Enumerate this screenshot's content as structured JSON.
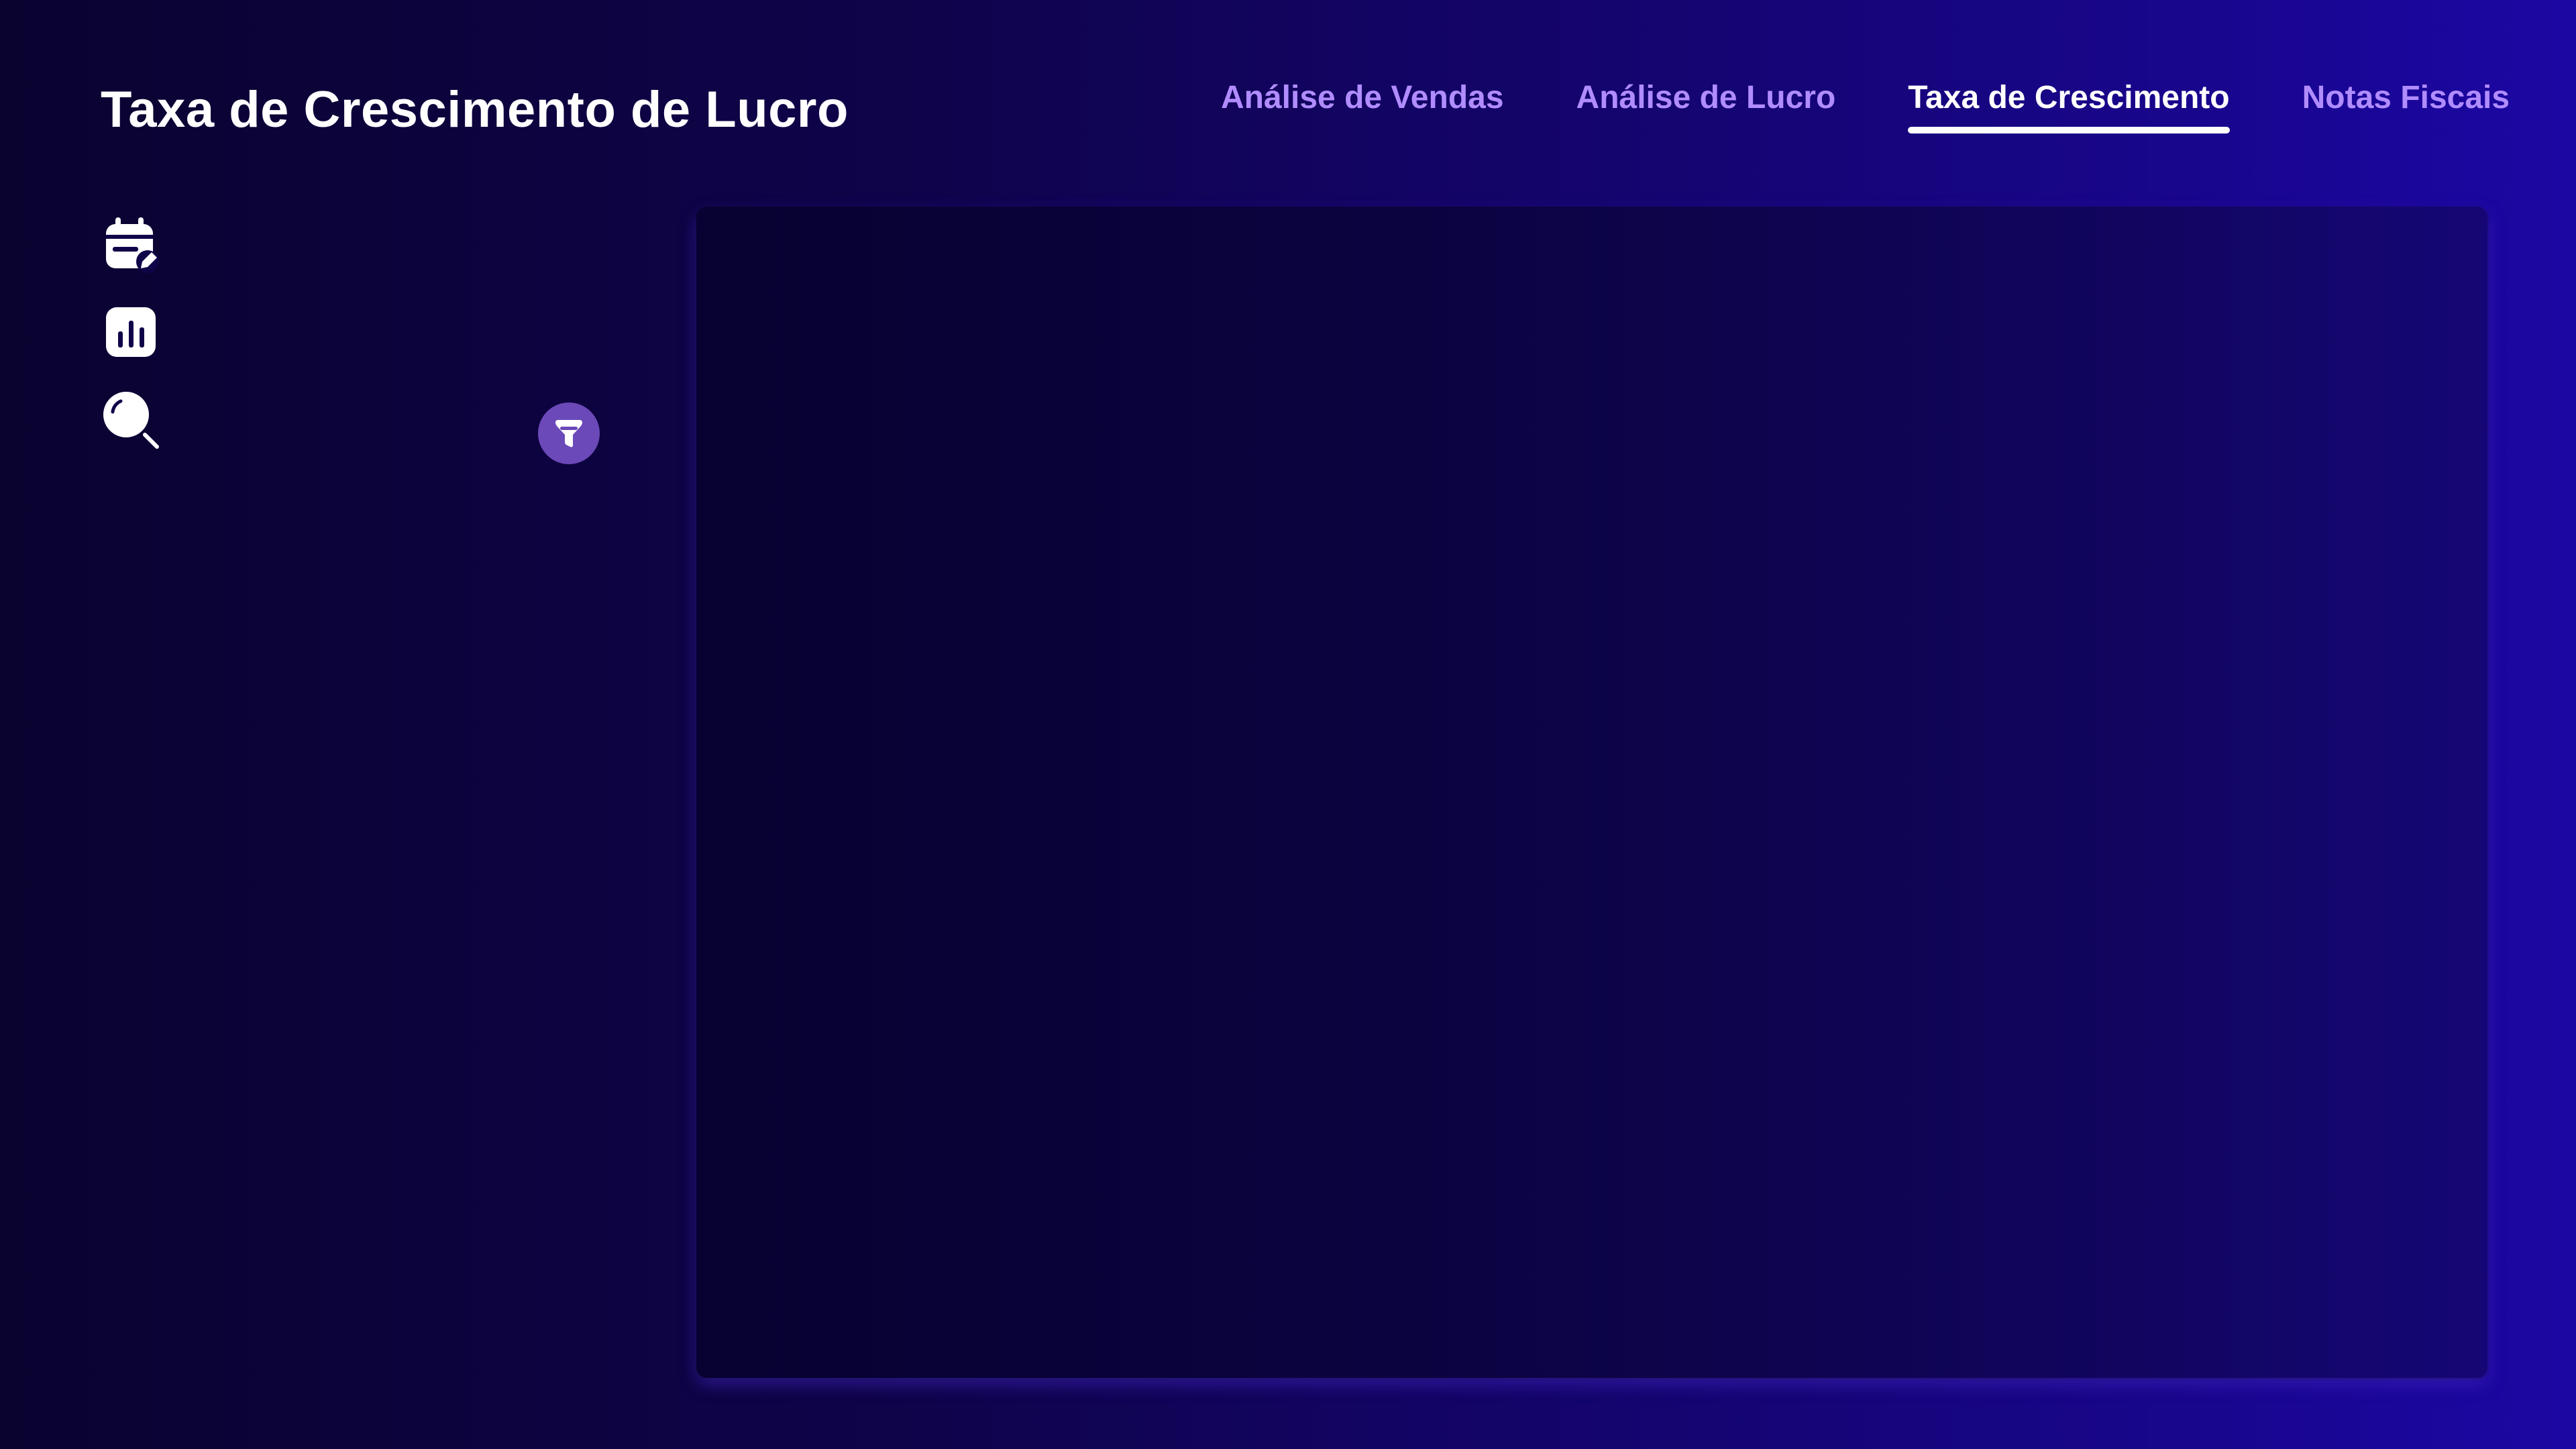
{
  "header": {
    "title": "Taxa de Crescimento de Lucro"
  },
  "nav": {
    "tabs": [
      {
        "label": "Análise de Vendas",
        "active": false
      },
      {
        "label": "Análise de Lucro",
        "active": false
      },
      {
        "label": "Taxa de Crescimento",
        "active": true
      },
      {
        "label": "Notas Fiscais",
        "active": false
      }
    ]
  },
  "sidebar": {
    "icons": [
      "calendar-edit-icon",
      "bar-chart-icon",
      "search-icon"
    ],
    "filter_icon": "filter-icon"
  },
  "colors": {
    "background_start": "#0a0330",
    "background_end": "#1c07a3",
    "tab_inactive": "#b18cff",
    "tab_active": "#ffffff",
    "filter_button": "#6b49b8",
    "panel": "#0b0340"
  }
}
